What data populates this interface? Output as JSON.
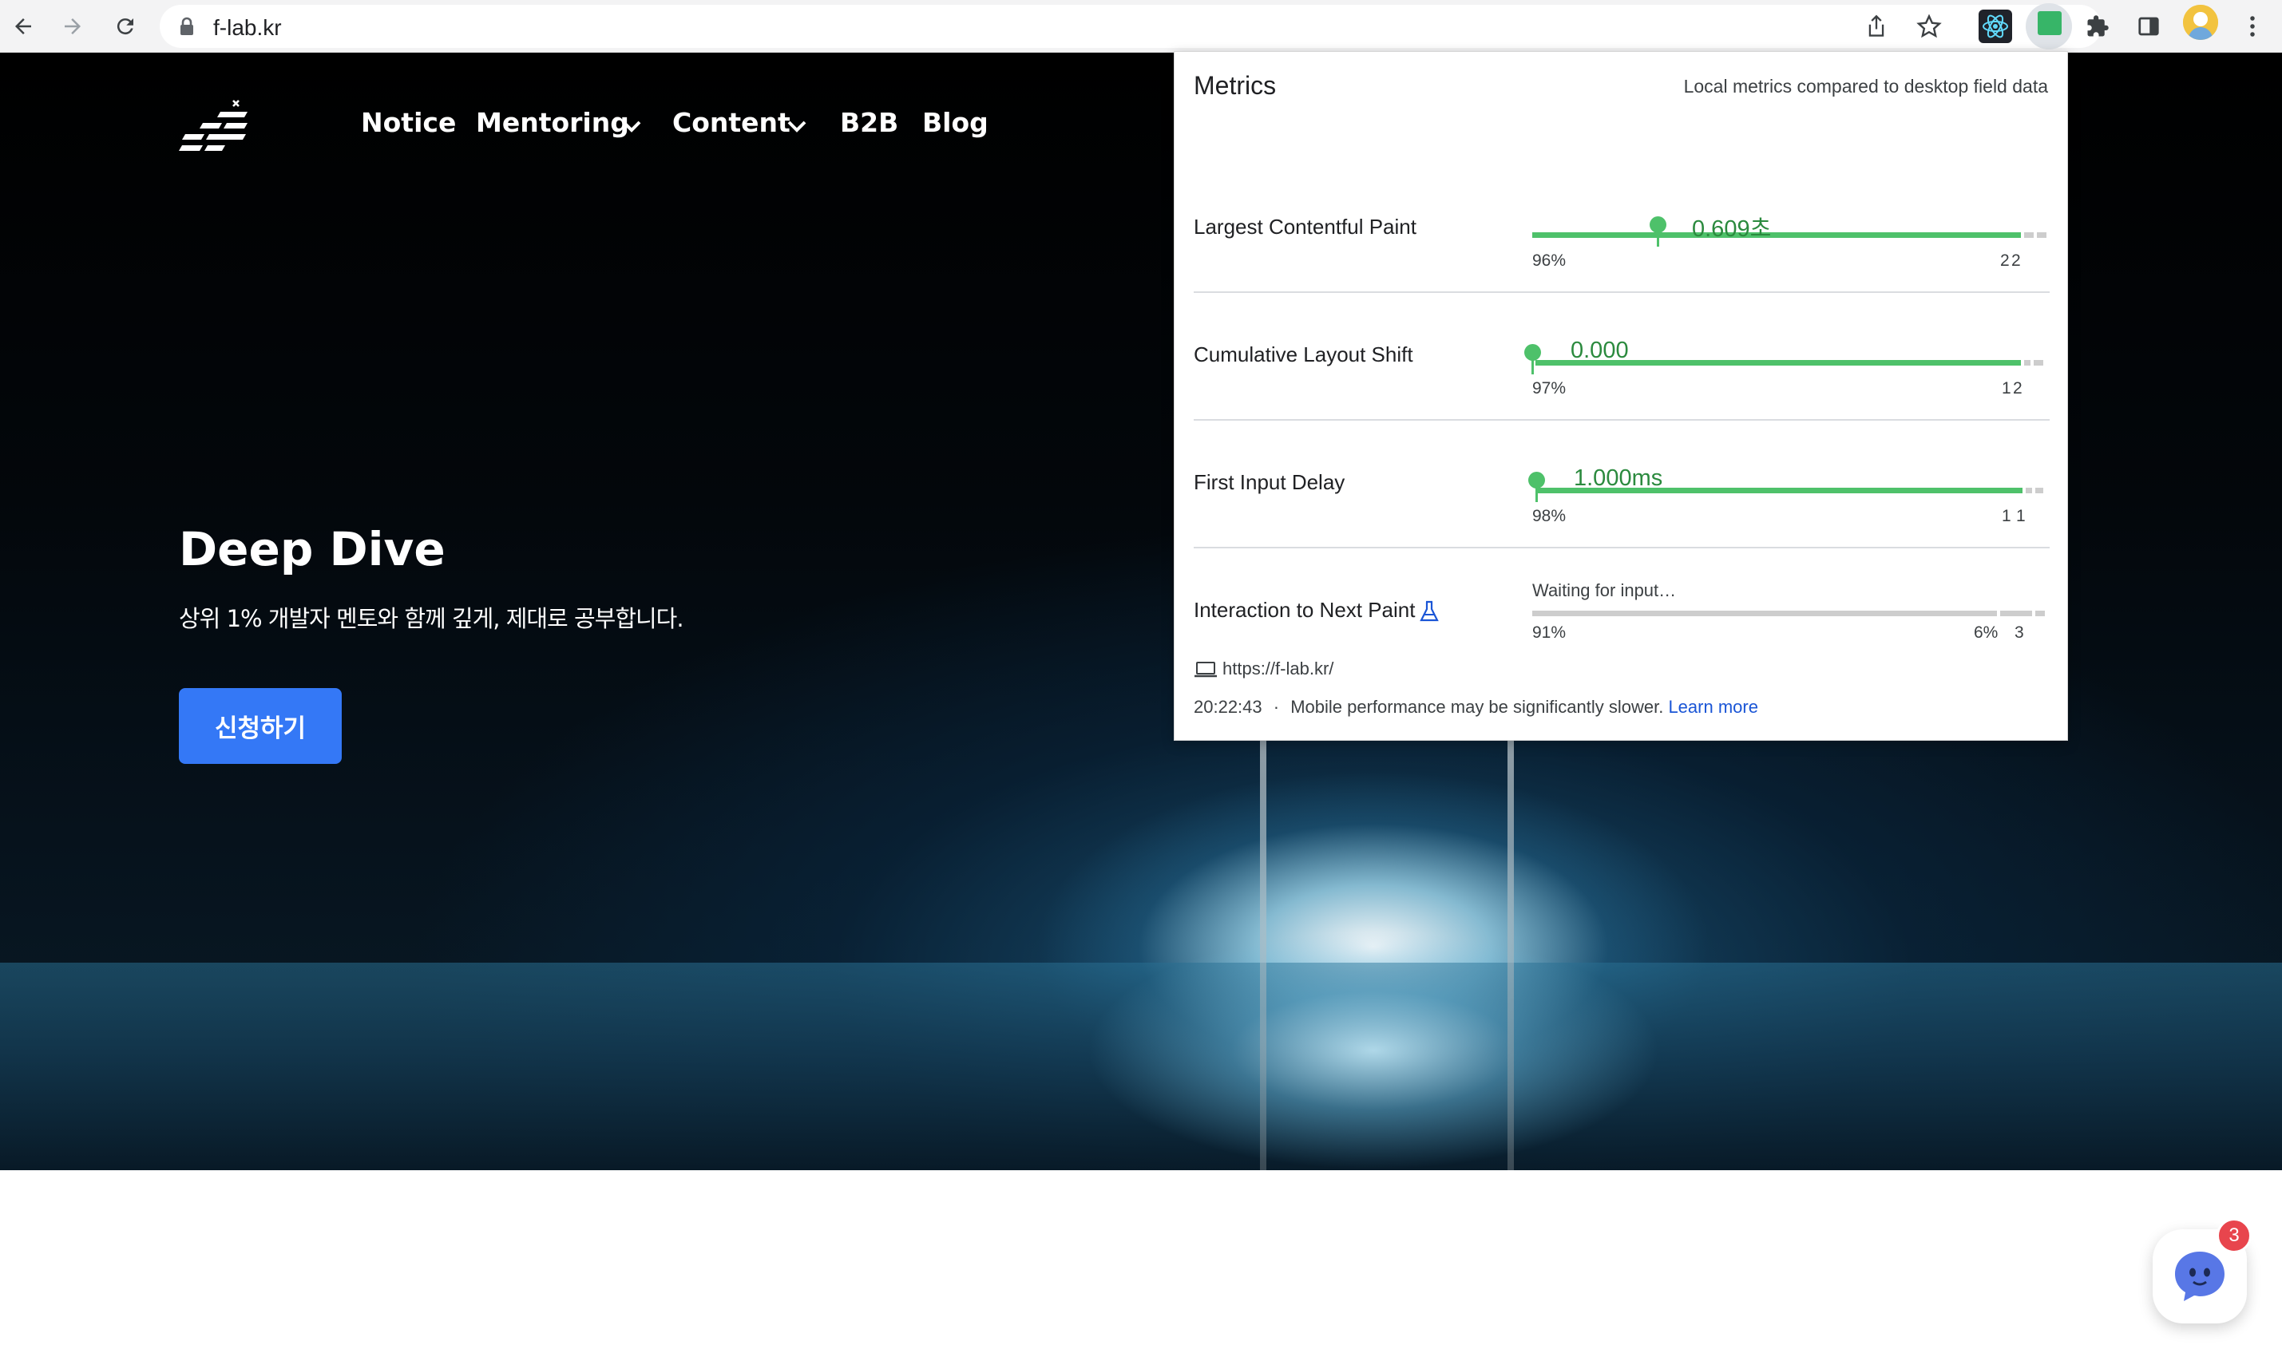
{
  "browser": {
    "url": "f-lab.kr"
  },
  "site": {
    "nav": [
      "Notice",
      "Mentoring",
      "Content",
      "B2B",
      "Blog"
    ],
    "hero_title": "Deep Dive",
    "hero_subtitle": "상위 1% 개발자 멘토와 함께 깊게, 제대로 공부합니다.",
    "cta_label": "신청하기",
    "chat_badge_count": "3"
  },
  "vitals_popup": {
    "title": "Metrics",
    "subtitle": "Local metrics compared to desktop field data",
    "metrics": [
      {
        "label": "Largest Contentful Paint",
        "value": "0.609초",
        "good_pct": "96%",
        "ni_pct": "2",
        "poor_pct": "2",
        "marker_fraction": 0.25
      },
      {
        "label": "Cumulative Layout Shift",
        "value": "0.000",
        "good_pct": "97%",
        "ni_pct": "1",
        "poor_pct": "2",
        "marker_fraction": 0.0
      },
      {
        "label": "First Input Delay",
        "value": "1.000ms",
        "good_pct": "98%",
        "ni_pct": "1",
        "poor_pct": "1",
        "marker_fraction": 0.01
      },
      {
        "label": "Interaction to Next Paint",
        "value": "Waiting for input…",
        "good_pct": "91%",
        "ni_pct": "6%",
        "poor_pct": "3"
      }
    ],
    "footer_url": "https://f-lab.kr/",
    "timestamp": "20:22:43",
    "separator": "·",
    "note": "Mobile performance may be significantly slower.",
    "learn_more": "Learn more"
  },
  "colors": {
    "good": "#4ec16a",
    "value_text": "#2b8a3e",
    "cta": "#3478f6",
    "link": "#1a55d6",
    "badge": "#e8454d"
  }
}
